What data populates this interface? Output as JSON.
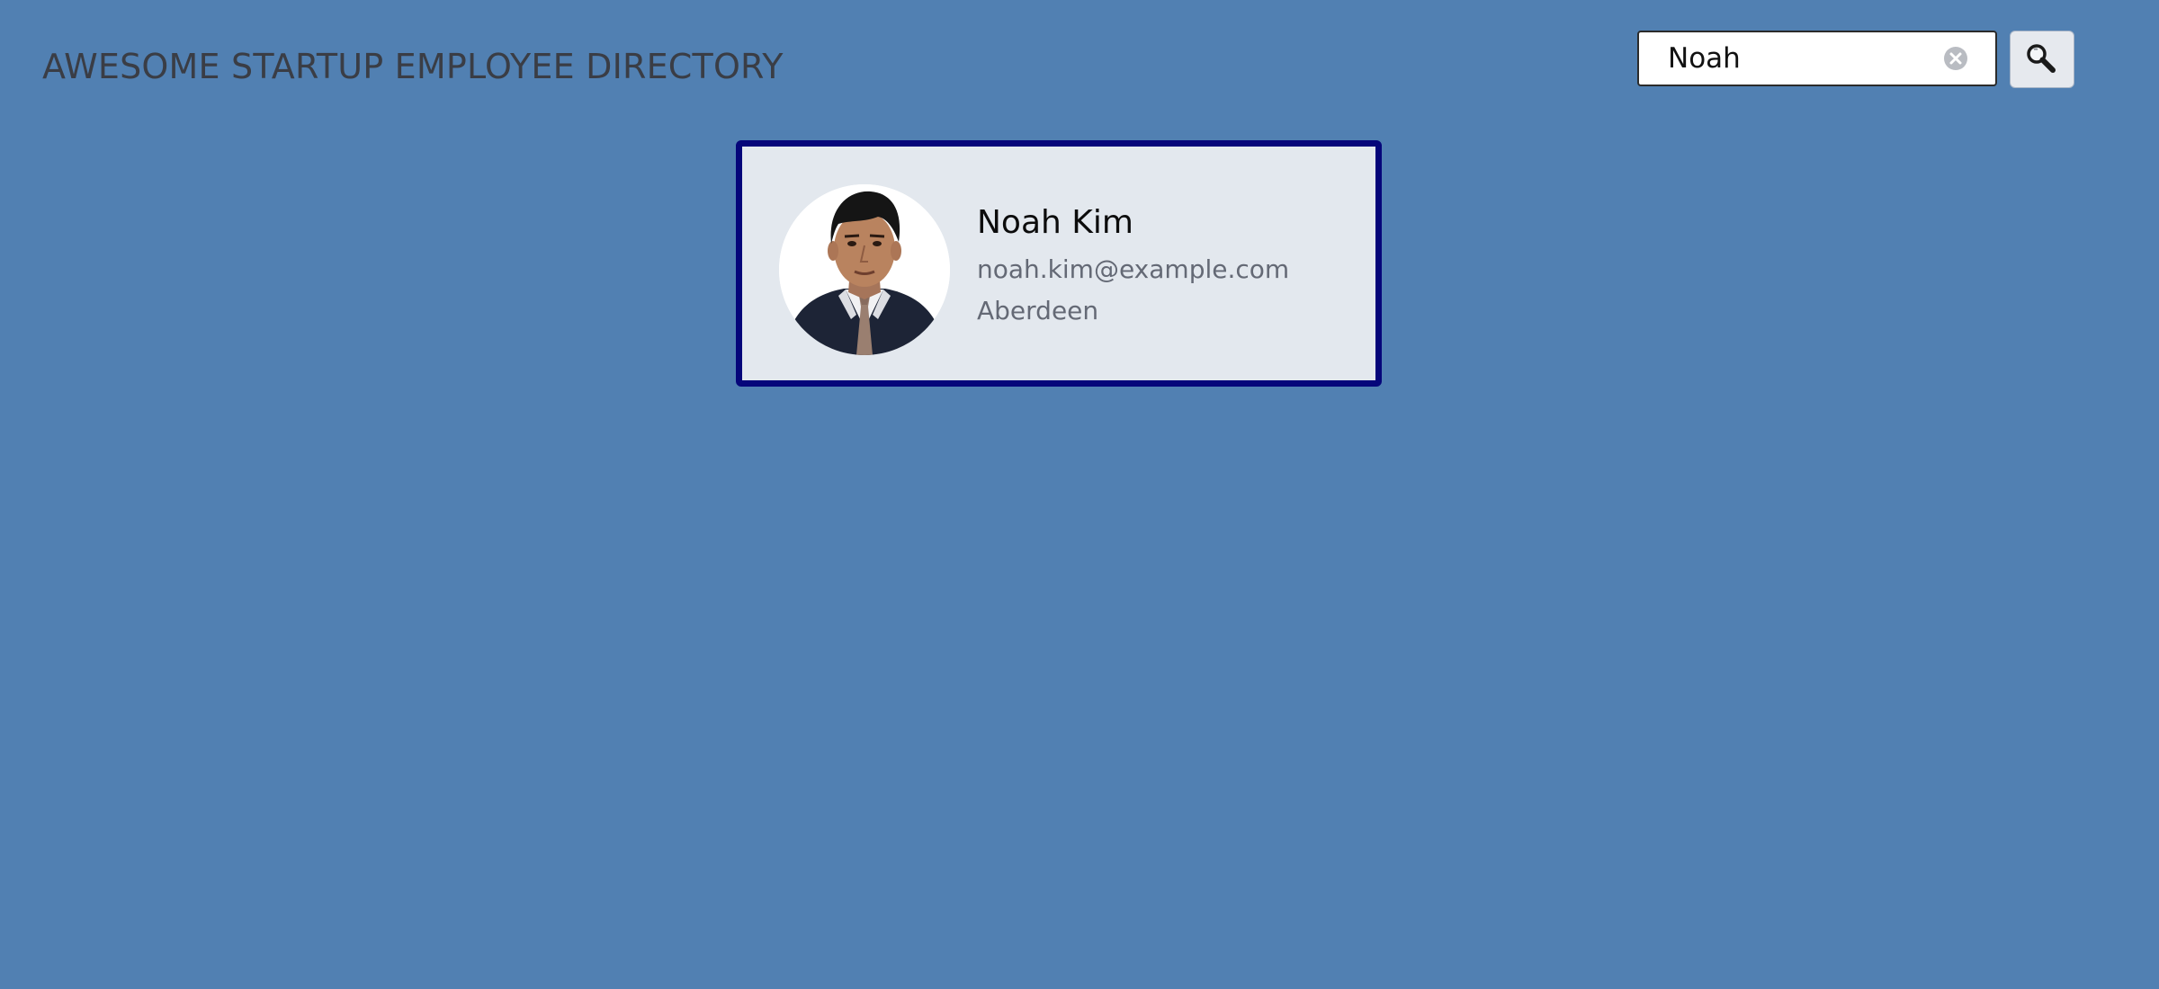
{
  "header": {
    "title": "AWESOME STARTUP EMPLOYEE DIRECTORY"
  },
  "search": {
    "value": "Noah",
    "clear_icon": "clear-circle-icon",
    "button_icon": "magnifying-glass-icon"
  },
  "results": [
    {
      "name": "Noah Kim",
      "email": "noah.kim@example.com",
      "location": "Aberdeen"
    }
  ],
  "colors": {
    "background": "#5180b2",
    "card_border": "#06067a",
    "card_background": "#e3e8ee"
  }
}
